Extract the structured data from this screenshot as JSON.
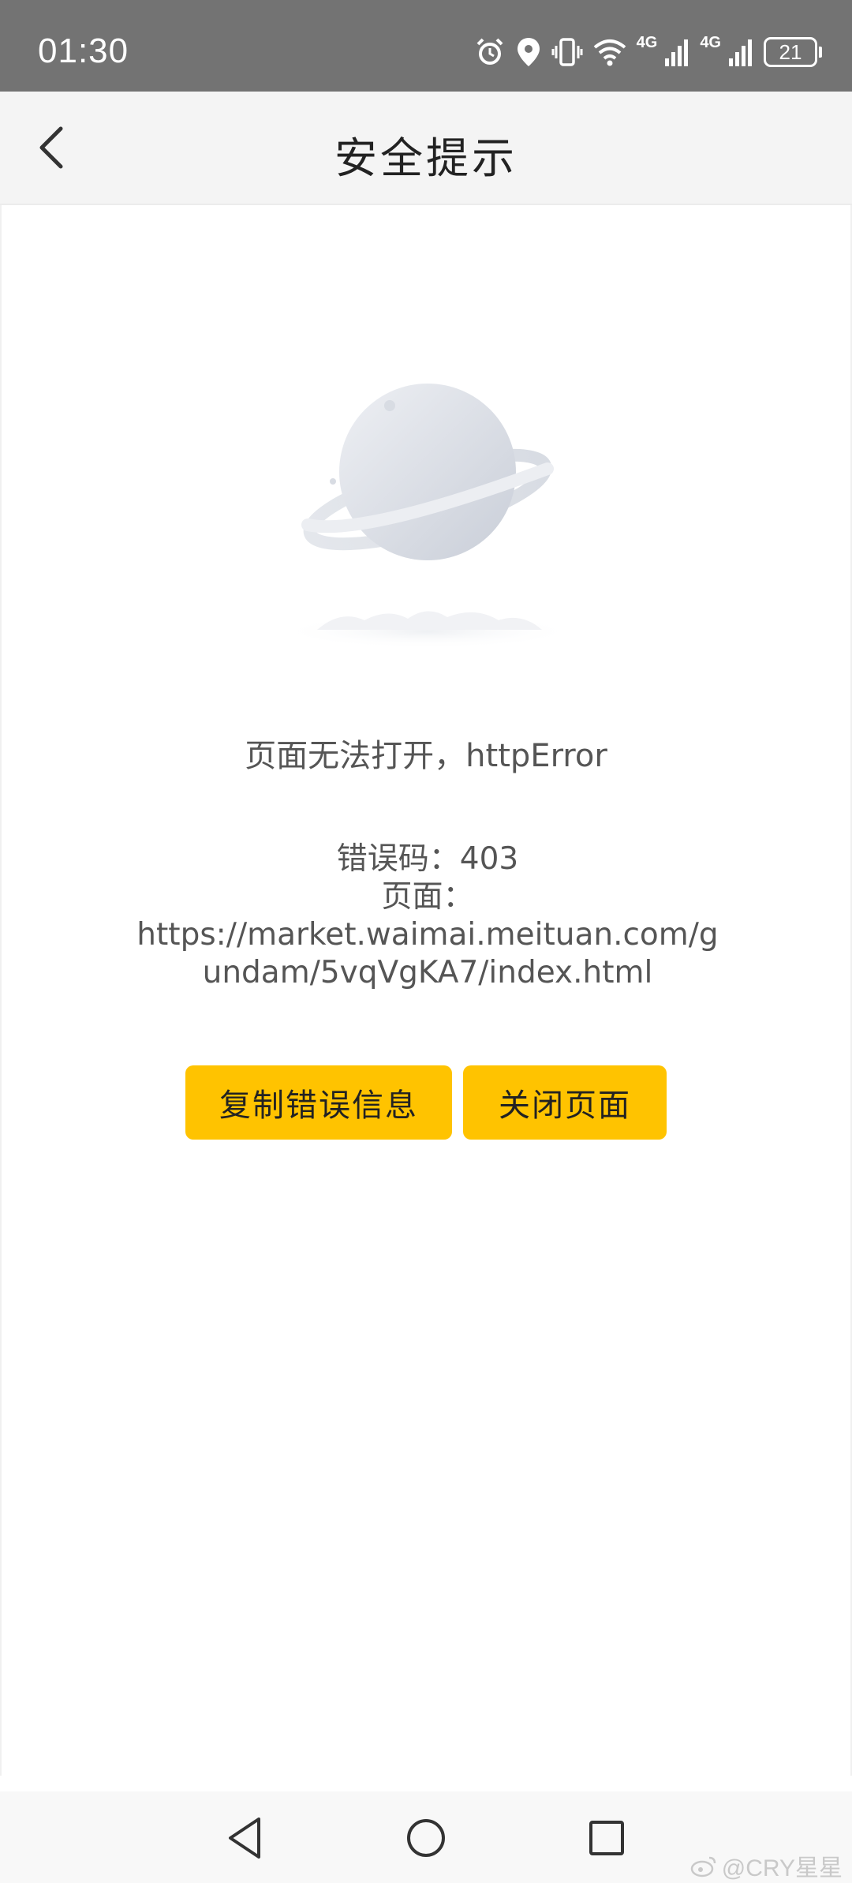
{
  "status_bar": {
    "time": "01:30",
    "net_label_1": "4G",
    "net_label_2": "4G",
    "battery_level": "21",
    "icons": [
      "alarm-icon",
      "location-icon",
      "vibrate-icon",
      "wifi-icon",
      "signal-icon",
      "signal-icon",
      "battery-icon"
    ]
  },
  "header": {
    "title": "安全提示",
    "back_icon": "chevron-left-icon"
  },
  "main": {
    "illustration": "planet-illustration",
    "message": "页面无法打开，httpError",
    "error_code_line": "错误码：403",
    "page_label": "页面：",
    "page_url": "https://market.waimai.meituan.com/gundam/5vqVgKA7/index.html",
    "buttons": {
      "copy_label": "复制错误信息",
      "close_label": "关闭页面"
    },
    "colors": {
      "button": "#ffc300",
      "text": "#555555"
    }
  },
  "nav_bar": {
    "icons": [
      "nav-back-icon",
      "nav-home-icon",
      "nav-recents-icon"
    ]
  },
  "watermark": {
    "text": "@CRY星星"
  }
}
